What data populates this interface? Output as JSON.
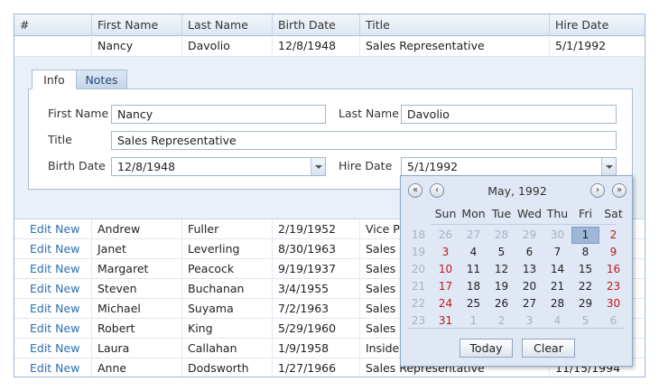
{
  "columns": [
    "#",
    "First Name",
    "Last Name",
    "Birth Date",
    "Title",
    "Hire Date"
  ],
  "editing_row": {
    "first_name": "Nancy",
    "last_name": "Davolio",
    "birth_date": "12/8/1948",
    "title": "Sales Representative",
    "hire_date": "5/1/1992"
  },
  "tabs": {
    "info": "Info",
    "notes": "Notes"
  },
  "form": {
    "first_name_label": "First Name",
    "first_name_value": "Nancy",
    "last_name_label": "Last Name",
    "last_name_value": "Davolio",
    "title_label": "Title",
    "title_value": "Sales Representative",
    "birth_date_label": "Birth Date",
    "birth_date_value": "12/8/1948",
    "hire_date_label": "Hire Date",
    "hire_date_value": "5/1/1992"
  },
  "rows": [
    {
      "action": "Edit New",
      "first": "Andrew",
      "last": "Fuller",
      "birth": "2/19/1952",
      "title": "Vice Pr",
      "hire": ""
    },
    {
      "action": "Edit New",
      "first": "Janet",
      "last": "Leverling",
      "birth": "8/30/1963",
      "title": "Sales R",
      "hire": ""
    },
    {
      "action": "Edit New",
      "first": "Margaret",
      "last": "Peacock",
      "birth": "9/19/1937",
      "title": "Sales R",
      "hire": ""
    },
    {
      "action": "Edit New",
      "first": "Steven",
      "last": "Buchanan",
      "birth": "3/4/1955",
      "title": "Sales M",
      "hire": ""
    },
    {
      "action": "Edit New",
      "first": "Michael",
      "last": "Suyama",
      "birth": "7/2/1963",
      "title": "Sales R",
      "hire": ""
    },
    {
      "action": "Edit New",
      "first": "Robert",
      "last": "King",
      "birth": "5/29/1960",
      "title": "Sales R",
      "hire": ""
    },
    {
      "action": "Edit New",
      "first": "Laura",
      "last": "Callahan",
      "birth": "1/9/1958",
      "title": "Inside",
      "hire": ""
    },
    {
      "action": "Edit New",
      "first": "Anne",
      "last": "Dodsworth",
      "birth": "1/27/1966",
      "title": "Sales Representative",
      "hire": "11/15/1994"
    }
  ],
  "calendar": {
    "title": "May, 1992",
    "nav": {
      "prev_year": "«",
      "prev_month": "‹",
      "next_month": "›",
      "next_year": "»"
    },
    "weekdays": [
      "Sun",
      "Mon",
      "Tue",
      "Wed",
      "Thu",
      "Fri",
      "Sat"
    ],
    "weeks": [
      {
        "num": "18",
        "days": [
          {
            "d": "26",
            "other": true
          },
          {
            "d": "27",
            "other": true
          },
          {
            "d": "28",
            "other": true
          },
          {
            "d": "29",
            "other": true
          },
          {
            "d": "30",
            "other": true
          },
          {
            "d": "1",
            "selected": true
          },
          {
            "d": "2",
            "weekend": true
          }
        ]
      },
      {
        "num": "19",
        "days": [
          {
            "d": "3",
            "weekend": true
          },
          {
            "d": "4"
          },
          {
            "d": "5"
          },
          {
            "d": "6"
          },
          {
            "d": "7"
          },
          {
            "d": "8"
          },
          {
            "d": "9",
            "weekend": true
          }
        ]
      },
      {
        "num": "20",
        "days": [
          {
            "d": "10",
            "weekend": true
          },
          {
            "d": "11"
          },
          {
            "d": "12"
          },
          {
            "d": "13"
          },
          {
            "d": "14"
          },
          {
            "d": "15"
          },
          {
            "d": "16",
            "weekend": true
          }
        ]
      },
      {
        "num": "21",
        "days": [
          {
            "d": "17",
            "weekend": true
          },
          {
            "d": "18"
          },
          {
            "d": "19"
          },
          {
            "d": "20"
          },
          {
            "d": "21"
          },
          {
            "d": "22"
          },
          {
            "d": "23",
            "weekend": true
          }
        ]
      },
      {
        "num": "22",
        "days": [
          {
            "d": "24",
            "weekend": true
          },
          {
            "d": "25"
          },
          {
            "d": "26"
          },
          {
            "d": "27"
          },
          {
            "d": "28"
          },
          {
            "d": "29"
          },
          {
            "d": "30",
            "weekend": true
          }
        ]
      },
      {
        "num": "23",
        "days": [
          {
            "d": "31",
            "weekend": true
          },
          {
            "d": "1",
            "other": true
          },
          {
            "d": "2",
            "other": true
          },
          {
            "d": "3",
            "other": true
          },
          {
            "d": "4",
            "other": true
          },
          {
            "d": "5",
            "other": true
          },
          {
            "d": "6",
            "other": true
          }
        ]
      }
    ],
    "today_label": "Today",
    "clear_label": "Clear"
  },
  "colors": {
    "accent": "#2a6fb4",
    "weekend": "#c4161c",
    "selected": "#9fb7d7"
  }
}
